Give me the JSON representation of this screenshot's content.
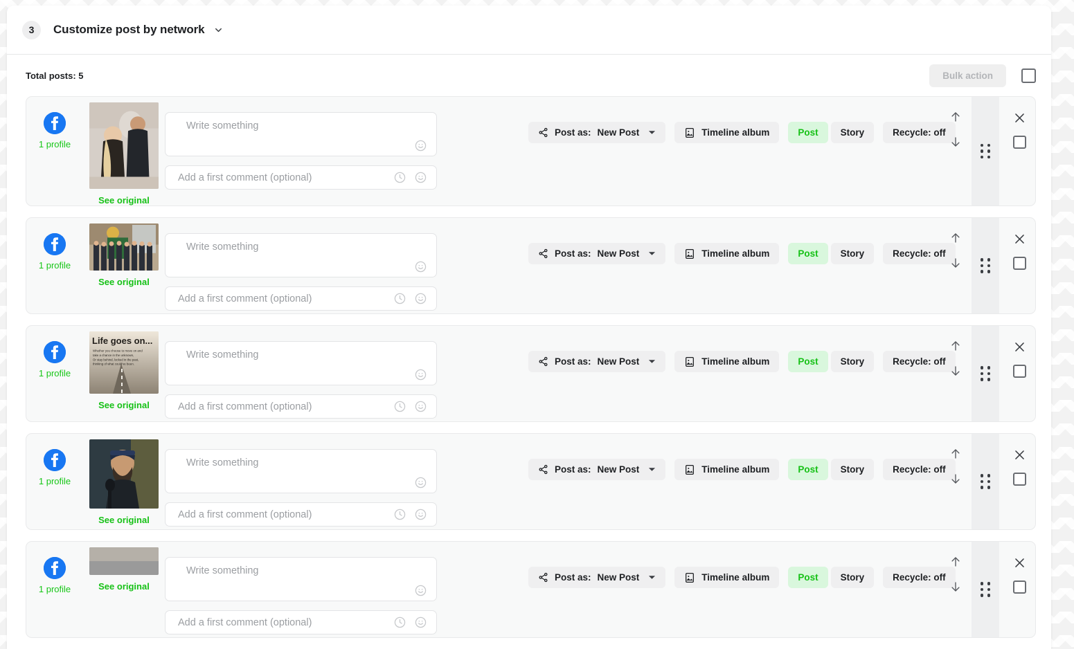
{
  "header": {
    "step_number": "3",
    "title": "Customize post by network",
    "caret_icon": "chevron-down-icon"
  },
  "toolbar": {
    "total_posts_label": "Total posts: 5",
    "bulk_action_label": "Bulk action",
    "select_all_checkbox": "select-all-checkbox"
  },
  "common": {
    "network_icon": "facebook-icon",
    "profile_count_label": "1 profile",
    "see_original_label": "See original",
    "write_placeholder": "Write something",
    "comment_placeholder": "Add a first comment (optional)",
    "post_as_label": "Post as:",
    "post_as_value": "New Post",
    "album_label": "Timeline album",
    "post_label": "Post",
    "story_label": "Story",
    "recycle_label": "Recycle: off",
    "share_icon": "share-icon",
    "album_icon": "image-icon",
    "emoji_icon": "emoji-icon",
    "clock_icon": "clock-icon",
    "move_up_icon": "arrow-up-icon",
    "move_down_icon": "arrow-down-icon",
    "drag_icon": "drag-handle-icon",
    "close_icon": "close-icon",
    "row_checkbox": "row-select-checkbox"
  },
  "colors": {
    "facebook_blue": "#1877f2",
    "accent_green": "#16c116",
    "active_pill_bg": "#d9f7dd",
    "pill_bg": "#efeff0",
    "row_bg": "#f8f9f9"
  },
  "rows": [
    {
      "thumb_kind": "portrait-couple",
      "thumb_height": 125
    },
    {
      "thumb_kind": "group-photo",
      "thumb_height": 68
    },
    {
      "thumb_kind": "quote-card",
      "thumb_height": 90
    },
    {
      "thumb_kind": "podcast-portrait",
      "thumb_height": 100
    },
    {
      "thumb_kind": "partial-row",
      "thumb_height": 40
    }
  ]
}
